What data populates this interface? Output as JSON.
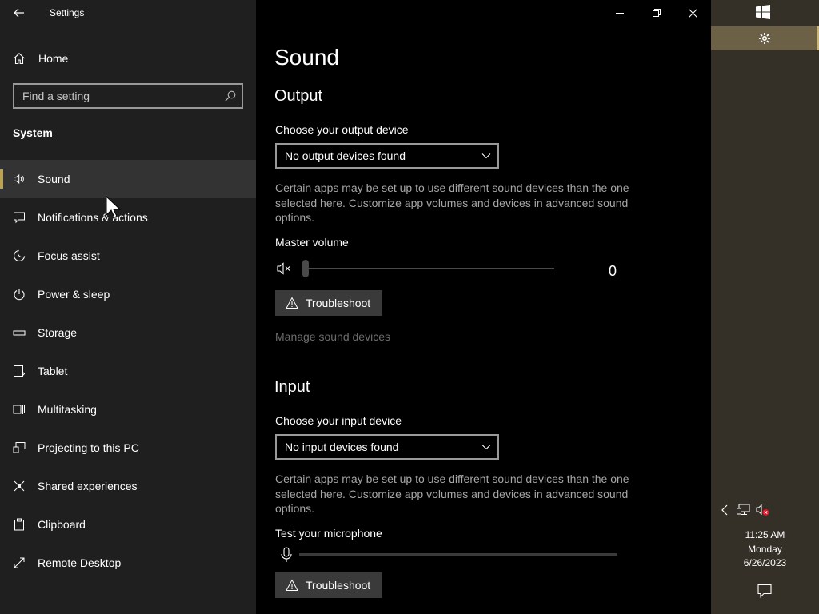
{
  "app": {
    "title": "Settings"
  },
  "sidebar": {
    "home_label": "Home",
    "search_placeholder": "Find a setting",
    "section_label": "System",
    "items": [
      {
        "label": "Sound",
        "icon": "speaker-icon",
        "active": true
      },
      {
        "label": "Notifications & actions",
        "icon": "notification-icon"
      },
      {
        "label": "Focus assist",
        "icon": "moon-icon"
      },
      {
        "label": "Power & sleep",
        "icon": "power-icon"
      },
      {
        "label": "Storage",
        "icon": "storage-icon"
      },
      {
        "label": "Tablet",
        "icon": "tablet-icon"
      },
      {
        "label": "Multitasking",
        "icon": "multitasking-icon"
      },
      {
        "label": "Projecting to this PC",
        "icon": "projecting-icon"
      },
      {
        "label": "Shared experiences",
        "icon": "shared-experiences-icon"
      },
      {
        "label": "Clipboard",
        "icon": "clipboard-icon"
      },
      {
        "label": "Remote Desktop",
        "icon": "remote-desktop-icon"
      }
    ]
  },
  "main": {
    "title": "Sound",
    "output": {
      "heading": "Output",
      "device_label": "Choose your output device",
      "device_value": "No output devices found",
      "description": "Certain apps may be set up to use different sound devices than the one selected here. Customize app volumes and devices in advanced sound options.",
      "master_volume_label": "Master volume",
      "volume_value": "0",
      "volume_level": 0,
      "troubleshoot_label": "Troubleshoot",
      "manage_link": "Manage sound devices"
    },
    "input": {
      "heading": "Input",
      "device_label": "Choose your input device",
      "device_value": "No input devices found",
      "description": "Certain apps may be set up to use different sound devices than the one selected here. Customize app volumes and devices in advanced sound options.",
      "test_label": "Test your microphone",
      "mic_level": 0,
      "troubleshoot_label": "Troubleshoot"
    }
  },
  "taskbar": {
    "time": "11:25 AM",
    "day": "Monday",
    "date": "6/26/2023"
  },
  "colors": {
    "sidebar_bg": "#1f1f1f",
    "active_item_bg": "#333333",
    "accent": "#b9a456",
    "taskbar_bg": "#353027",
    "muted_text": "#a6a6a6",
    "mute_error": "#e81123"
  }
}
